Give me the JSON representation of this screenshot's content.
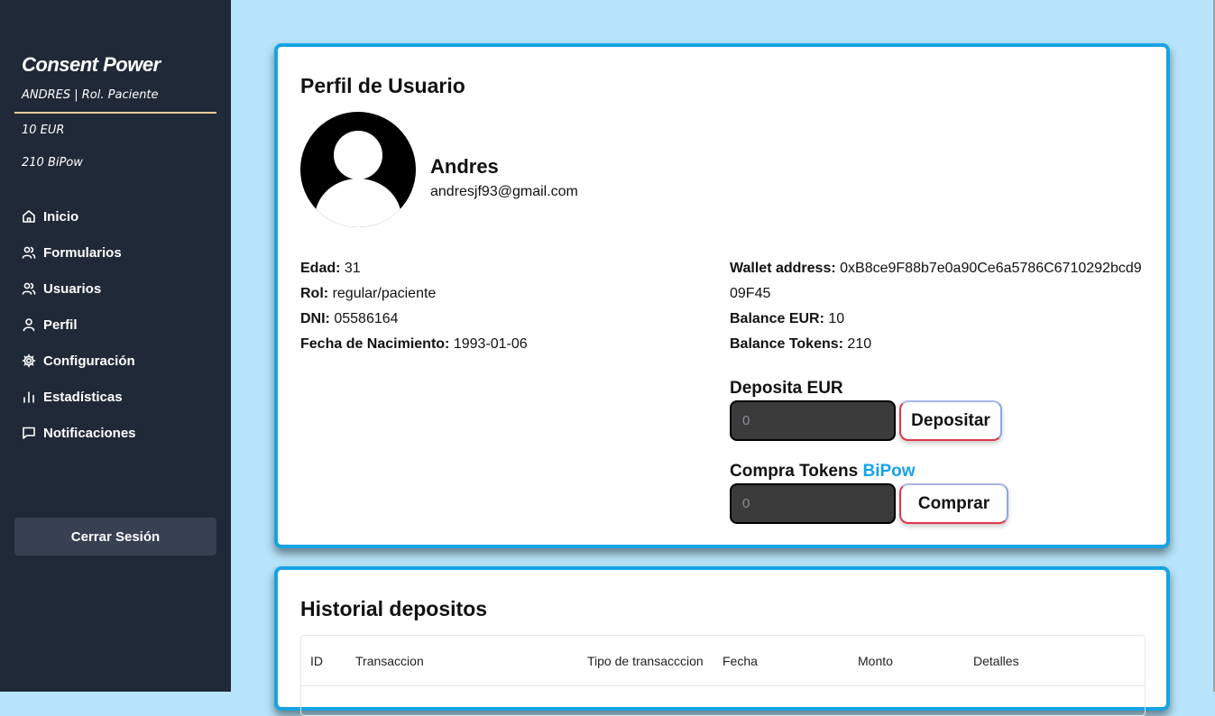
{
  "sidebar": {
    "brand": "Consent Power",
    "user_line": "ANDRES | Rol. Paciente",
    "eur": "10 EUR",
    "bipow": "210 BiPow",
    "items": [
      {
        "label": "Inicio",
        "icon": "home-icon"
      },
      {
        "label": "Formularios",
        "icon": "users-icon"
      },
      {
        "label": "Usuarios",
        "icon": "users-icon"
      },
      {
        "label": "Perfil",
        "icon": "user-icon"
      },
      {
        "label": "Configuración",
        "icon": "gear-icon"
      },
      {
        "label": "Estadísticas",
        "icon": "bar-chart-icon"
      },
      {
        "label": "Notificaciones",
        "icon": "message-icon"
      }
    ],
    "logout_label": "Cerrar Sesión"
  },
  "profile": {
    "title": "Perfil de Usuario",
    "name": "Andres",
    "email": "andresjf93@gmail.com",
    "left": [
      {
        "label": "Edad:",
        "value": "31"
      },
      {
        "label": "Rol:",
        "value": "regular/paciente"
      },
      {
        "label": "DNI:",
        "value": "05586164"
      },
      {
        "label": "Fecha de Nacimiento:",
        "value": "1993-01-06"
      }
    ],
    "wallet_label": "Wallet address:",
    "wallet_value": "0xB8ce9F88b7e0a90Ce6a5786C6710292bcd909F45",
    "balance_eur_label": "Balance EUR:",
    "balance_eur_value": "10",
    "balance_tokens_label": "Balance Tokens:",
    "balance_tokens_value": "210",
    "deposit": {
      "label": "Deposita EUR",
      "placeholder": "0",
      "button": "Depositar"
    },
    "buy": {
      "label": "Compra Tokens ",
      "highlight": "BiPow",
      "placeholder": "0",
      "button": "Comprar"
    }
  },
  "history": {
    "title": "Historial depositos",
    "columns": [
      "ID",
      "Transaccion",
      "Tipo de transacccion",
      "Fecha",
      "Monto",
      "Detalles"
    ]
  },
  "colors": {
    "accent": "#16a4e3",
    "sidebar": "#1f2937",
    "background": "#b7e4fa"
  }
}
